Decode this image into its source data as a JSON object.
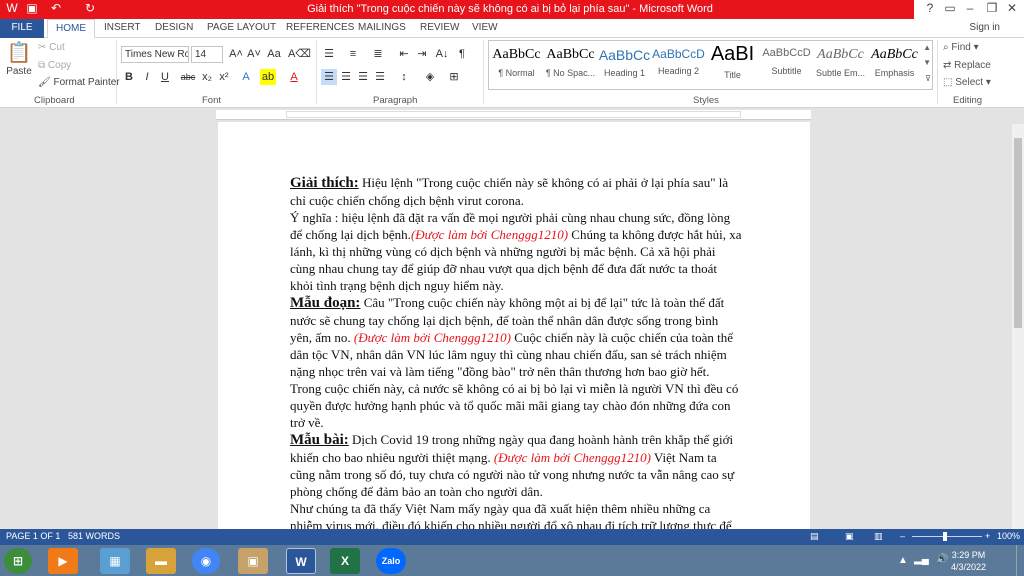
{
  "window": {
    "title": "Giải thích \"Trong cuộc chiến này sẽ không có ai bị bỏ lại phía sau\" -  Microsoft Word"
  },
  "quick_access": {
    "save_icon": "save-icon",
    "undo_icon": "undo-icon",
    "redo_icon": "redo-icon"
  },
  "tabs": [
    "FILE",
    "HOME",
    "INSERT",
    "DESIGN",
    "PAGE LAYOUT",
    "REFERENCES",
    "MAILINGS",
    "REVIEW",
    "VIEW"
  ],
  "signin": "Sign in",
  "clipboard": {
    "paste": "Paste",
    "cut": "Cut",
    "copy": "Copy",
    "format_painter": "Format Painter",
    "label": "Clipboard"
  },
  "font": {
    "name": "Times New Ro",
    "size": "14",
    "label": "Font"
  },
  "paragraph": {
    "label": "Paragraph"
  },
  "styles": {
    "label": "Styles",
    "items": [
      {
        "preview": "AaBbCc",
        "name": "¶ Normal"
      },
      {
        "preview": "AaBbCc",
        "name": "¶ No Spac..."
      },
      {
        "preview": "AaBbCc",
        "name": "Heading 1"
      },
      {
        "preview": "AaBbCcD",
        "name": "Heading 2"
      },
      {
        "preview": "AaBI",
        "name": "Title"
      },
      {
        "preview": "AaBbCcD",
        "name": "Subtitle"
      },
      {
        "preview": "AaBbCc",
        "name": "Subtle Em..."
      },
      {
        "preview": "AaBbCc",
        "name": "Emphasis"
      }
    ]
  },
  "editing": {
    "find": "Find",
    "replace": "Replace",
    "select": "Select",
    "label": "Editing"
  },
  "document": {
    "p1_head": "Giải thích:",
    "p1_text": " Hiệu lệnh \"Trong cuộc chiến này sẽ không có ai phải ở lại phía sau\" là chỉ cuộc chiến chống dịch bệnh virut corona.",
    "p2_text": "Ý nghĩa : hiệu lệnh đã đặt ra vấn đề mọi người phải cùng nhau chung sức, đồng lòng để chống lại dịch bệnh.",
    "p2_red": "(Được làm bởi Chenggg1210)",
    "p2_rest": " Chúng ta không được hắt hủi, xa lánh, kì thị những vùng có dịch bệnh và những người bị mắc bệnh. Cả xã hội phải cùng nhau chung tay để giúp đỡ nhau vượt qua dịch bệnh để đưa đất nước ta thoát khỏi tình trạng bệnh dịch nguy hiểm này.",
    "p3_head": "Mẫu đoạn:",
    "p3_text": " Câu \"Trong cuộc chiến này không một ai bị để lại\" tức là toàn thể đất nước sẽ chung tay chống lại dịch bệnh, để toàn thể nhân dân được sống trong bình yên, ấm no. ",
    "p3_red": "(Được làm bởi Chenggg1210)",
    "p3_rest": " Cuộc chiến này là cuộc chiến của toàn thể dân tộc VN, nhân dân VN lúc lâm nguy thì cùng nhau chiến đấu, san sẻ trách nhiệm nặng nhọc trên vai và làm tiếng \"đồng bào\" trở nên thân thương hơn bao giờ hết. Trong cuộc chiến này, cả nước sẽ không có ai bị bỏ lại vì miễn là người VN thì đều có quyền được hưởng hạnh phúc và tổ quốc mãi mãi giang tay chào đón những đứa con trở về.",
    "p4_head": "Mẫu bài:",
    "p4_text": " Dịch Covid 19 trong những ngày qua đang hoành hành trên khắp thế giới khiến cho bao nhiêu người thiệt mạng. ",
    "p4_red": "(Được làm bởi Chenggg1210)",
    "p4_rest": " Việt Nam ta cũng nằm trong số đó, tuy chưa có người nào tử vong nhưng nước ta vẫn nâng cao sự phòng chống để đảm bảo an toàn cho người dân.",
    "p5_text": "Như chúng ta đã thấy Việt Nam mấy ngày qua đã xuất hiện thêm nhiều những ca nhiễm virus mới, điều đó khiến cho nhiều người đổ xô nhau đi tích trữ lương thực để phòng tránh dịch bệnh, khiến cho cảnh người người xô đẩy nhau trong"
  },
  "status": {
    "page": "PAGE 1 OF 1",
    "words": "581 WORDS",
    "zoom": "100%"
  },
  "taskbar": {
    "time": "3:29 PM",
    "date": "4/3/2022",
    "zalo": "Zalo"
  },
  "colors": {
    "word_blue": "#2b579a",
    "title_red": "#e8141b"
  }
}
